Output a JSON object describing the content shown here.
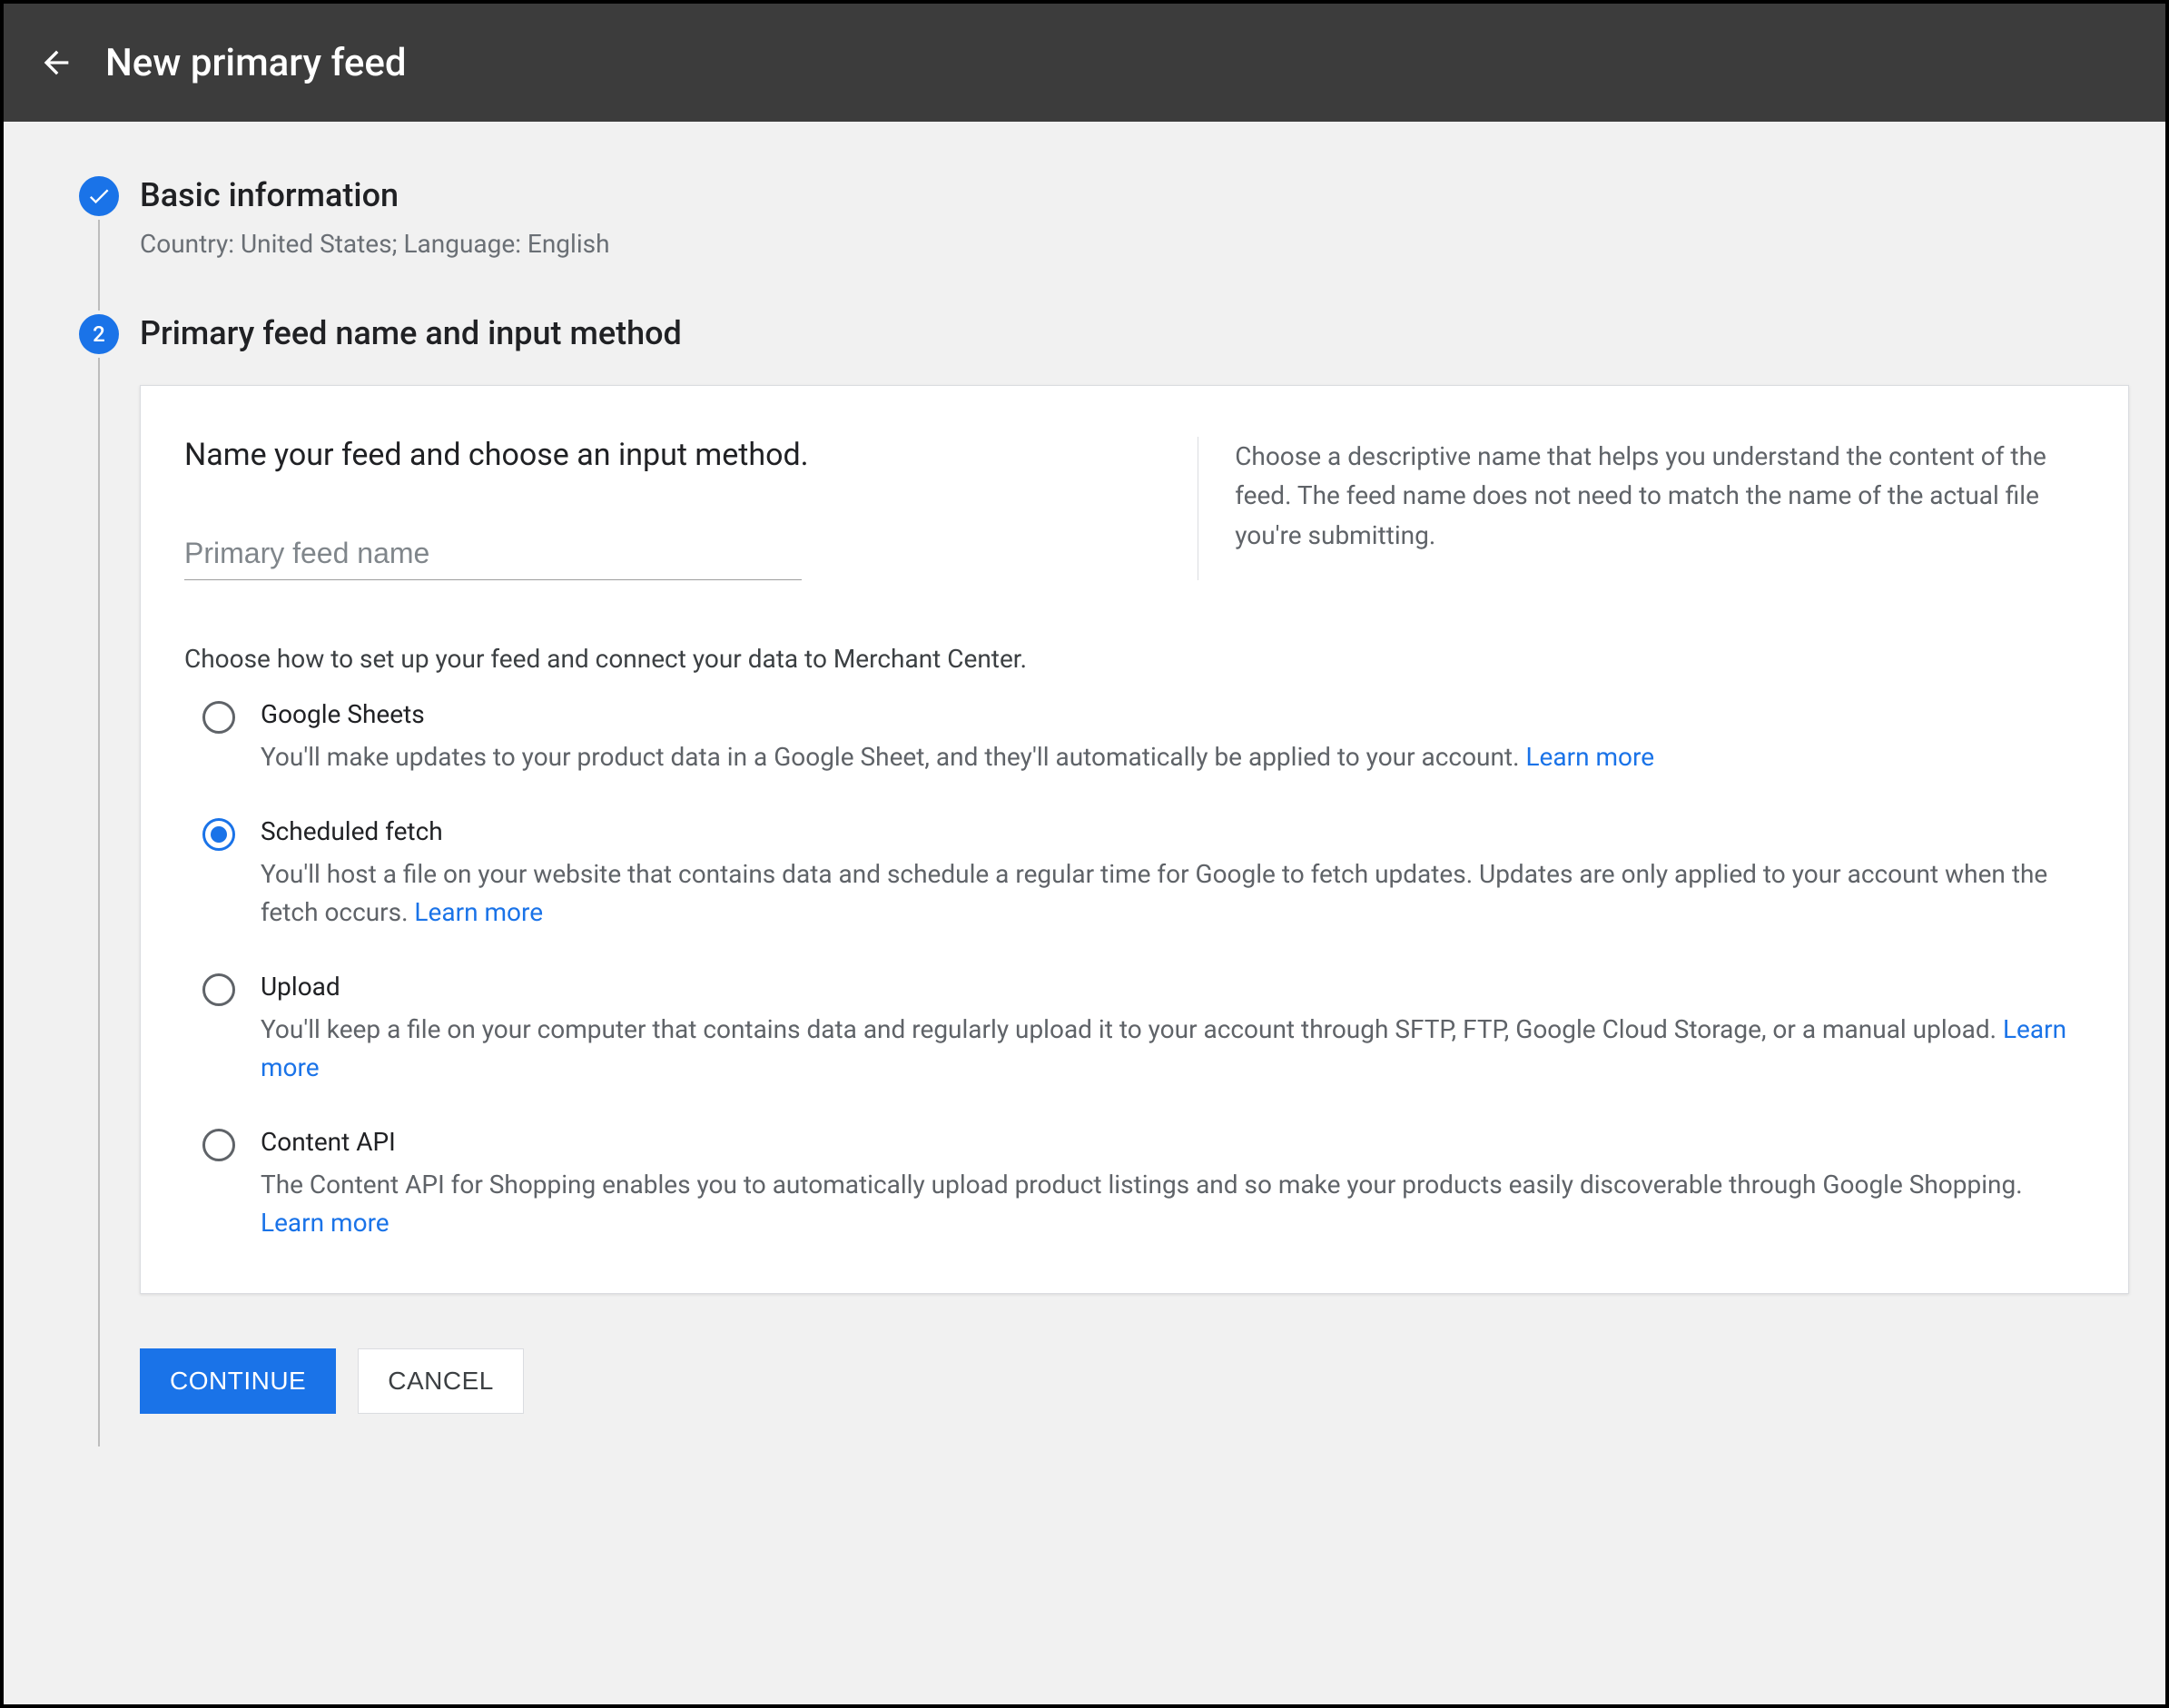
{
  "header": {
    "title": "New primary feed",
    "back_icon": "arrow-left"
  },
  "steps": {
    "basic_info": {
      "title": "Basic information",
      "summary": "Country: United States; Language: English",
      "status": "completed"
    },
    "feed_name": {
      "number": "2",
      "title": "Primary feed name and input method",
      "card_heading": "Name your feed and choose an input method.",
      "input_placeholder": "Primary feed name",
      "input_value": "",
      "help_text": "Choose a descriptive name that helps you understand the content of the feed. The feed name does not need to match the name of the actual file you're submitting.",
      "choose_text": "Choose how to set up your feed and connect your data to Merchant Center.",
      "options": [
        {
          "id": "google_sheets",
          "title": "Google Sheets",
          "desc": "You'll make updates to your product data in a Google Sheet, and they'll automatically be applied to your account. ",
          "learn_more": "Learn more",
          "selected": false
        },
        {
          "id": "scheduled_fetch",
          "title": "Scheduled fetch",
          "desc": "You'll host a file on your website that contains data and schedule a regular time for Google to fetch updates. Updates are only applied to your account when the fetch occurs. ",
          "learn_more": "Learn more",
          "selected": true
        },
        {
          "id": "upload",
          "title": "Upload",
          "desc": "You'll keep a file on your computer that contains data and regularly upload it to your account through SFTP, FTP, Google Cloud Storage, or a manual upload. ",
          "learn_more": "Learn more",
          "selected": false
        },
        {
          "id": "content_api",
          "title": "Content API",
          "desc": "The Content API for Shopping enables you to automatically upload product listings and so make your products easily discoverable through Google Shopping. ",
          "learn_more": "Learn more",
          "selected": false
        }
      ]
    }
  },
  "buttons": {
    "continue": "CONTINUE",
    "cancel": "CANCEL"
  },
  "colors": {
    "primary": "#1a73e8",
    "header_bg": "#3c3c3c",
    "text_secondary": "#5f6368"
  }
}
